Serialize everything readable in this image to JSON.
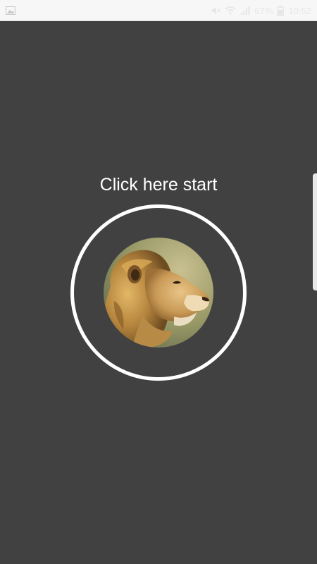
{
  "status_bar": {
    "left_icon": "gallery-icon",
    "right_icons": [
      "mute-icon",
      "wifi-icon",
      "signal-icon"
    ],
    "battery_percent": "67%",
    "battery_icon": "battery-icon",
    "time": "10:52"
  },
  "main": {
    "start_label": "Click here start",
    "image_icon": "lion-image"
  },
  "colors": {
    "background": "#414141",
    "status_bar": "#f7f7f7",
    "ring": "#ffffff",
    "text": "#ffffff"
  }
}
